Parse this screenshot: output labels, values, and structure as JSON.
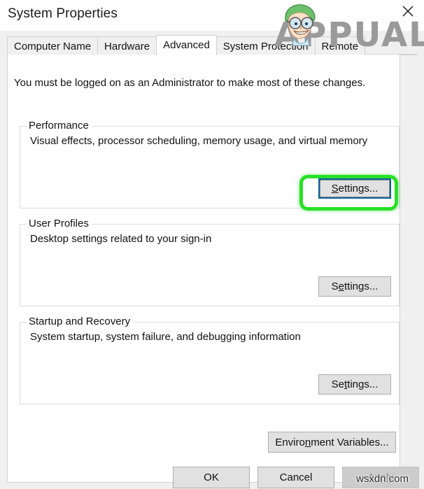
{
  "window": {
    "title": "System Properties",
    "close_icon": "close-icon"
  },
  "tabs": [
    {
      "label": "Computer Name",
      "selected": false
    },
    {
      "label": "Hardware",
      "selected": false
    },
    {
      "label": "Advanced",
      "selected": true
    },
    {
      "label": "System Protection",
      "selected": false
    },
    {
      "label": "Remote",
      "selected": false
    }
  ],
  "page": {
    "admin_note": "You must be logged on as an Administrator to make most of these changes."
  },
  "groups": [
    {
      "legend": "Performance",
      "description": "Visual effects, processor scheduling, memory usage, and virtual memory",
      "button": {
        "label_prefix": "",
        "accel": "S",
        "label_suffix": "ettings...",
        "focused": true,
        "highlighted": true
      }
    },
    {
      "legend": "User Profiles",
      "description": "Desktop settings related to your sign-in",
      "button": {
        "label_prefix": "S",
        "accel": "e",
        "label_suffix": "ttings...",
        "focused": false,
        "highlighted": false
      }
    },
    {
      "legend": "Startup and Recovery",
      "description": "System startup, system failure, and debugging information",
      "button": {
        "label_prefix": "Se",
        "accel": "t",
        "label_suffix": "tings...",
        "focused": false,
        "highlighted": false
      }
    }
  ],
  "environment_button": {
    "label_prefix": "Enviro",
    "accel": "n",
    "label_suffix": "ment Variables..."
  },
  "footer": {
    "ok": "OK",
    "cancel": "Cancel",
    "apply_prefix": "",
    "apply_accel": "A",
    "apply_suffix": "pply",
    "apply_disabled": true
  },
  "watermarks": {
    "appuals": "APPUALS",
    "wsxdn": "wsxdn.com"
  },
  "colors": {
    "accent_focus": "#0a64a0",
    "highlight_ring": "#28e028",
    "dialog_bg": "#f0f0f0",
    "page_bg": "#ffffff",
    "button_face": "#e1e1e1",
    "disabled_text": "#8d8d8d"
  }
}
